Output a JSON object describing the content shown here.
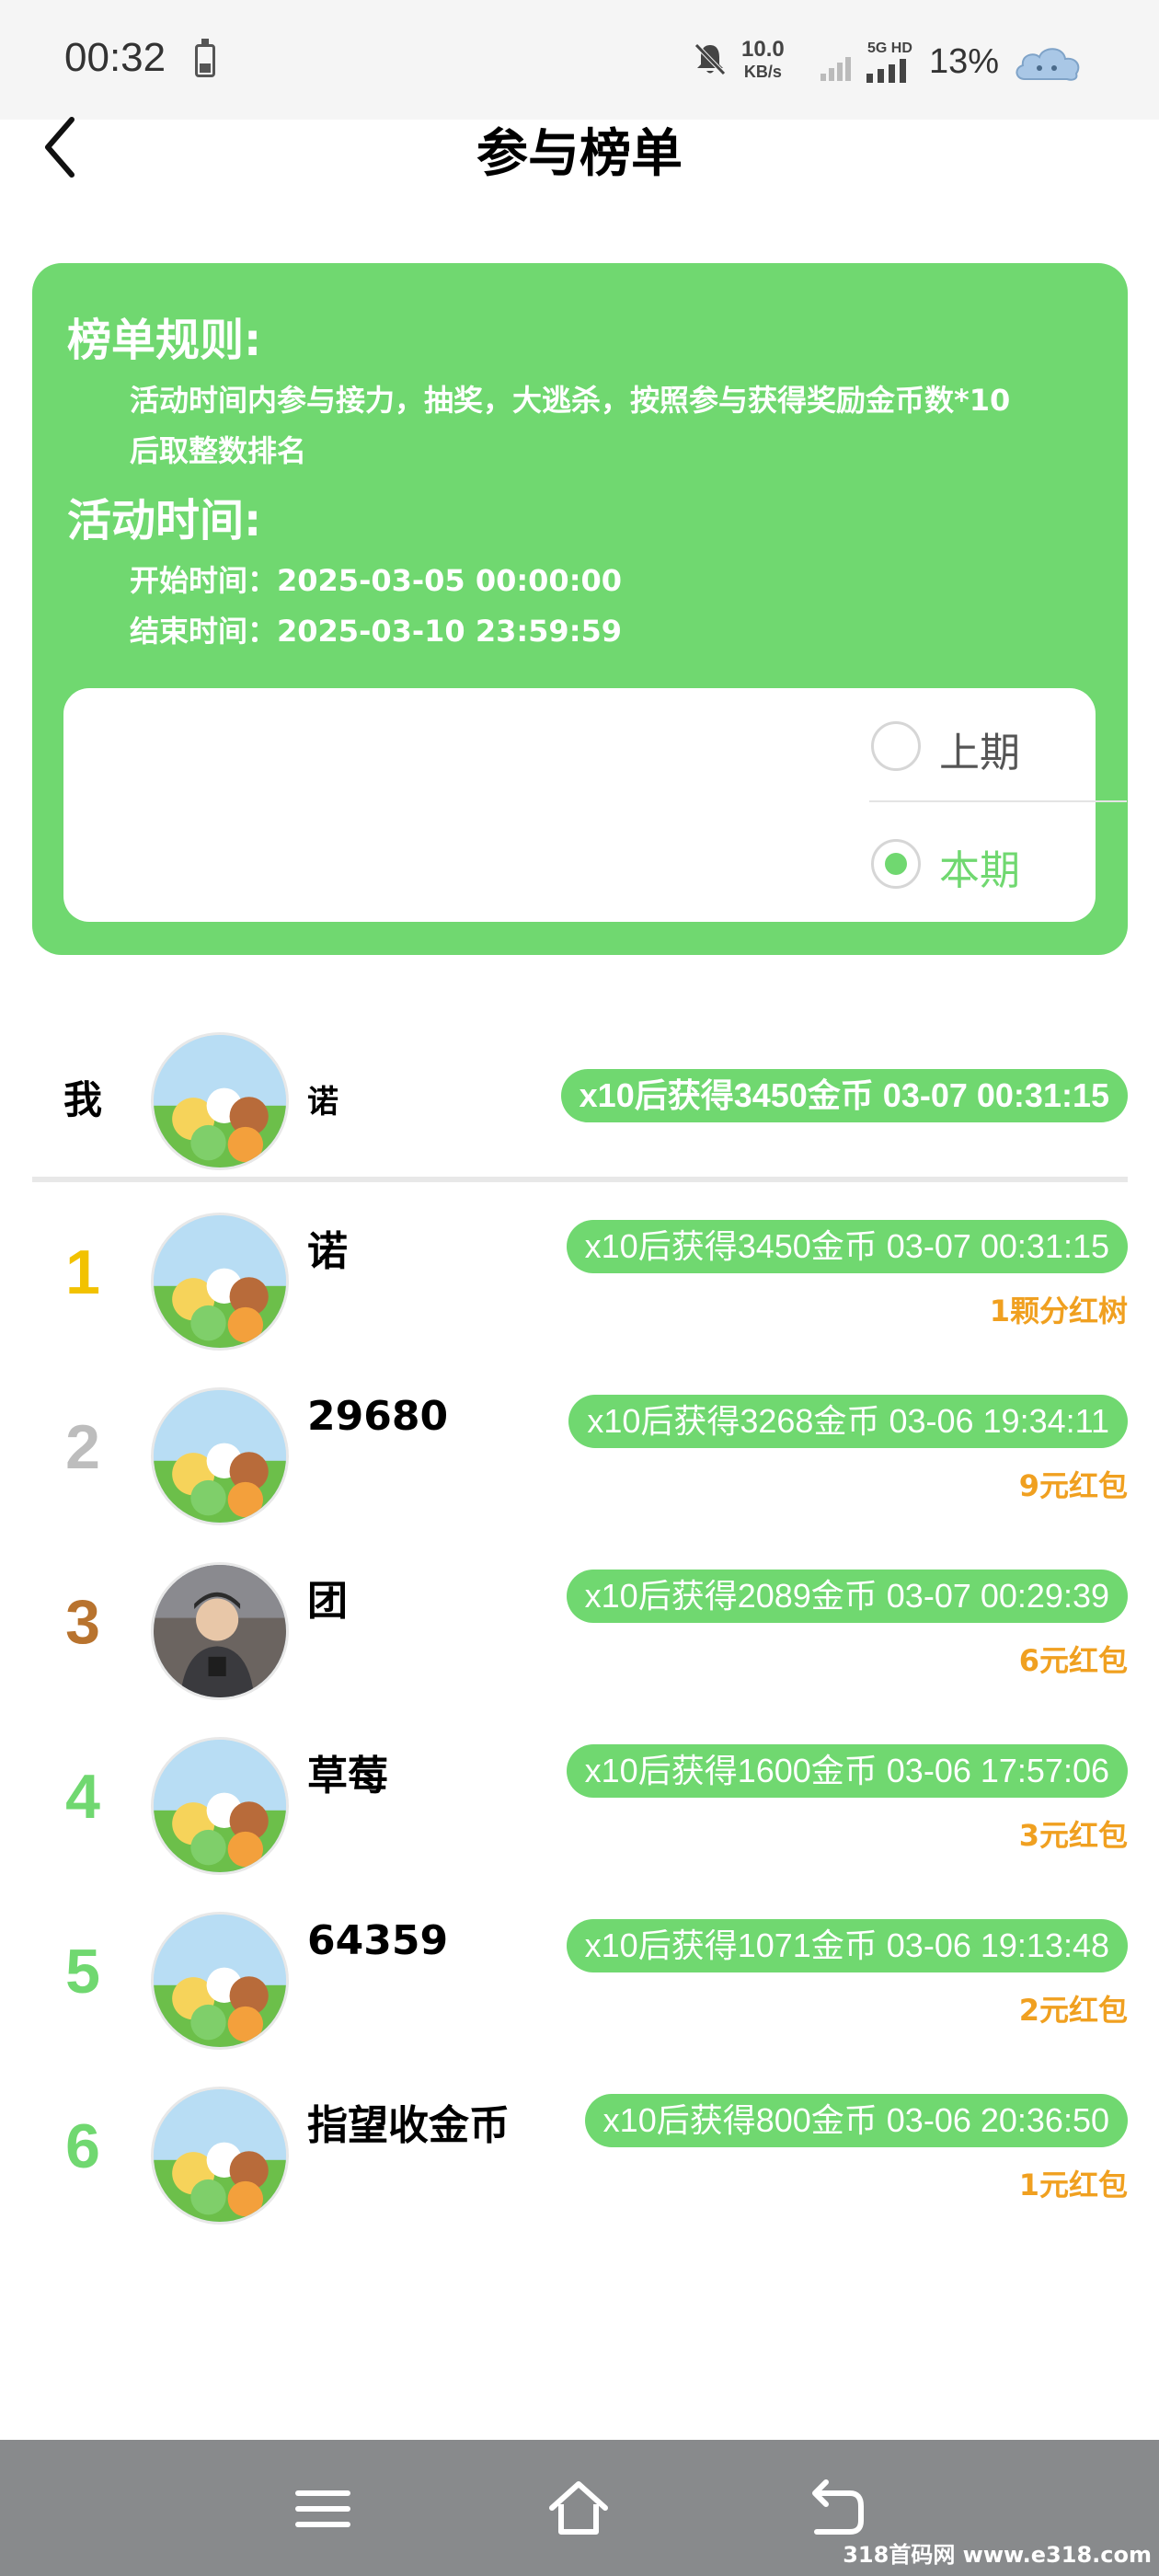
{
  "status_bar": {
    "time": "00:32",
    "net_speed_value": "10.0",
    "net_speed_unit": "KB/s",
    "network_label": "5G HD",
    "battery_percent": "13%"
  },
  "header": {
    "title": "参与榜单"
  },
  "rules": {
    "rules_heading": "榜单规则:",
    "rules_line1": "活动时间内参与接力，抽奖，大逃杀，按照参与获得奖励金币数*10",
    "rules_line2": "后取整数排名",
    "time_heading": "活动时间:",
    "start_time": "开始时间：2025-03-05 00:00:00",
    "end_time": "结束时间：2025-03-10 23:59:59"
  },
  "period": {
    "options": [
      {
        "label": "上期",
        "selected": false
      },
      {
        "label": "本期",
        "selected": true
      }
    ]
  },
  "me": {
    "rank_label": "我",
    "name": "诺",
    "badge": "x10后获得3450金币 03-07 00:31:15"
  },
  "leaderboard": [
    {
      "rank": "1",
      "name": "诺",
      "badge": "x10后获得3450金币 03-07 00:31:15",
      "reward": "1颗分红树",
      "rank_color": "#f2c200"
    },
    {
      "rank": "2",
      "name": "29680",
      "badge": "x10后获得3268金币 03-06 19:34:11",
      "reward": "9元红包",
      "rank_color": "#bdbdbd"
    },
    {
      "rank": "3",
      "name": "团",
      "badge": "x10后获得2089金币 03-07 00:29:39",
      "reward": "6元红包",
      "rank_color": "#b8732e"
    },
    {
      "rank": "4",
      "name": "草莓",
      "badge": "x10后获得1600金币 03-06 17:57:06",
      "reward": "3元红包",
      "rank_color": "#70d870"
    },
    {
      "rank": "5",
      "name": "64359",
      "badge": "x10后获得1071金币 03-06 19:13:48",
      "reward": "2元红包",
      "rank_color": "#70d870"
    },
    {
      "rank": "6",
      "name": "指望收金币",
      "badge": "x10后获得800金币 03-06 20:36:50",
      "reward": "1元红包",
      "rank_color": "#70d870"
    }
  ],
  "watermark": "318首码网 www.e318.com",
  "colors": {
    "accent": "#70d870",
    "reward": "#f0a020"
  }
}
